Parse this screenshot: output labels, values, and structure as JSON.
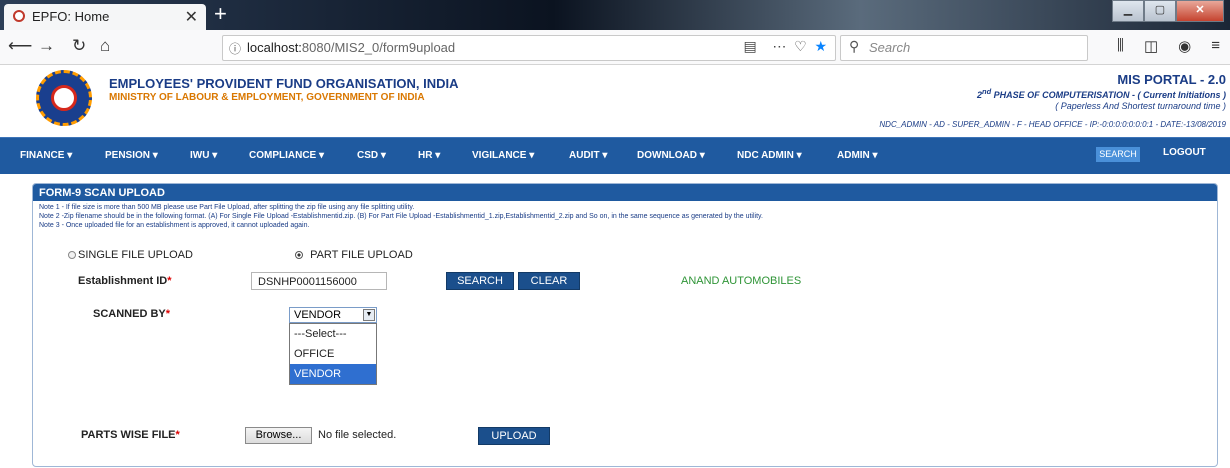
{
  "browser": {
    "tab_title": "EPFO: Home",
    "url_prefix": "localhost:",
    "url_rest": "8080/MIS2_0/form9upload",
    "search_placeholder": "Search"
  },
  "site": {
    "org_name": "EMPLOYEES' PROVIDENT FUND ORGANISATION, INDIA",
    "ministry": "MINISTRY OF LABOUR & EMPLOYMENT, GOVERNMENT OF INDIA",
    "portal_title": "MIS PORTAL - 2.0",
    "phase_sup": "nd",
    "phase_num": "2",
    "phase_text": " PHASE OF COMPUTERISATION -  ( Current Initiations )",
    "paperless": "( Paperless And Shortest turnaround time )",
    "user_info": "NDC_ADMIN  - AD - SUPER_ADMIN - F - HEAD OFFICE - IP:-0:0:0:0:0:0:0:1  - DATE:-13/08/2019"
  },
  "menu": {
    "items": [
      "FINANCE ▾",
      "PENSION ▾",
      "IWU ▾",
      "COMPLIANCE ▾",
      "CSD ▾",
      "HR ▾",
      "VIGILANCE ▾",
      "AUDIT ▾",
      "DOWNLOAD ▾",
      "NDC ADMIN ▾",
      "ADMIN ▾"
    ],
    "search": "SEARCH",
    "logout": "LOGOUT"
  },
  "form": {
    "title": "FORM-9 SCAN UPLOAD",
    "notes": [
      "Note 1 - If file size is more than 500 MB please use Part File Upload, after splitting the zip file using any file splitting utility.",
      "Note 2 -Zip filename should be in the following format. (A) For Single File Upload -Establishmentid.zip. (B) For Part File Upload -Establishmentid_1.zip,Establishmentid_2.zip and So on, in the same sequence as generated by the utility.",
      "Note 3 - Once uploaded file for an establishment is approved, it cannot uploaded again."
    ],
    "radio_single": "SINGLE FILE UPLOAD",
    "radio_part": "PART FILE UPLOAD",
    "selected_mode": "PART FILE UPLOAD",
    "est_label": "Establishment ID",
    "est_value": "DSNHP0001156000",
    "search_btn": "SEARCH",
    "clear_btn": "CLEAR",
    "company_name": "ANAND AUTOMOBILES",
    "scanned_label": "SCANNED BY",
    "scanned_value": "VENDOR",
    "scanned_options": [
      "---Select---",
      "OFFICE",
      "VENDOR"
    ],
    "parts_label": "PARTS WISE FILE",
    "browse_btn": "Browse...",
    "no_file": "No file selected.",
    "upload_btn": "UPLOAD",
    "required_mark": "*"
  },
  "colors": {
    "brand_blue": "#1f5aa0",
    "button_blue": "#1b4f8c",
    "company_green": "#2e9436",
    "ministry_orange": "#d97700"
  }
}
